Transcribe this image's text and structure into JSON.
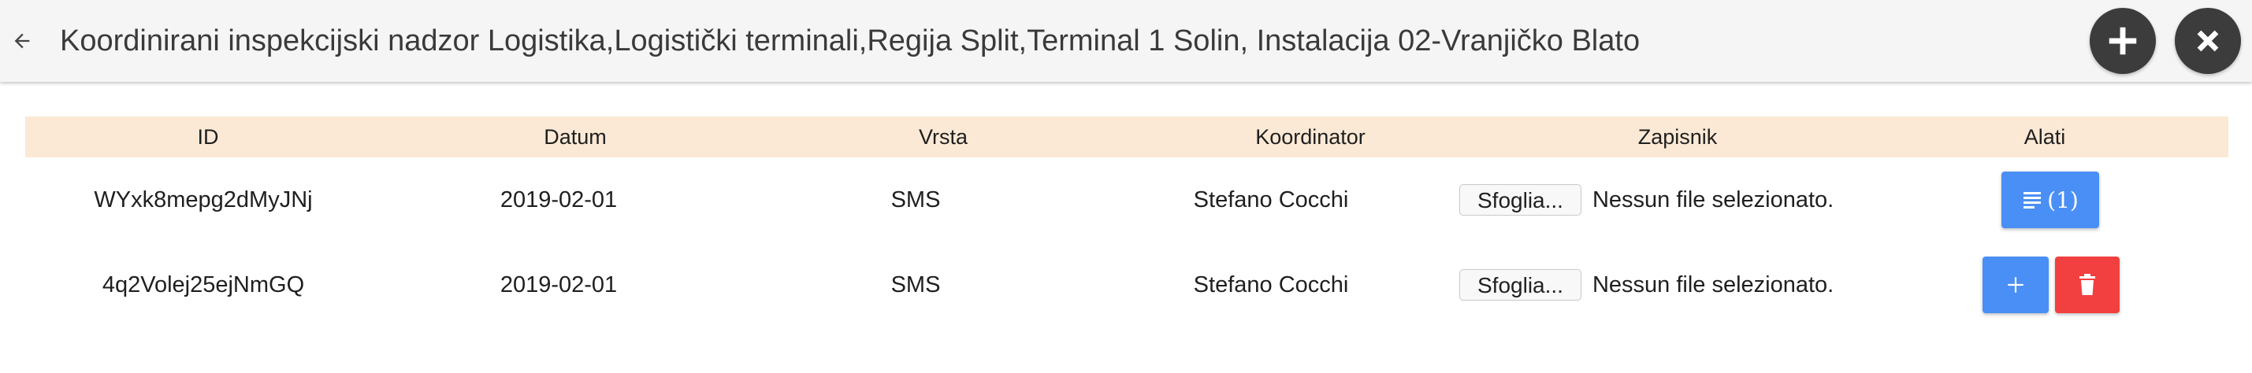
{
  "header": {
    "title": "Koordinirani inspekcijski nadzor Logistika,Logistički terminali,Regija Split,Terminal 1 Solin, Instalacija 02-Vranjičko Blato",
    "back_icon": "arrow-left-icon",
    "add_icon": "plus-circle-icon",
    "close_icon": "close-circle-icon"
  },
  "table": {
    "columns": [
      "ID",
      "Datum",
      "Vrsta",
      "Koordinator",
      "Zapisnik",
      "Alati"
    ],
    "rows": [
      {
        "id": "WYxk8mepg2dMyJNj",
        "datum": "2019-02-01",
        "vrsta": "SMS",
        "koordinator": "Stefano Cocchi",
        "file_button": "Sfoglia...",
        "file_status": "Nessun file selezionato.",
        "tools": {
          "list_count": "(1)"
        }
      },
      {
        "id": "4q2Volej25ejNmGQ",
        "datum": "2019-02-01",
        "vrsta": "SMS",
        "koordinator": "Stefano Cocchi",
        "file_button": "Sfoglia...",
        "file_status": "Nessun file selezionato."
      }
    ]
  },
  "colors": {
    "appbar_bg": "#f5f5f5",
    "header_row_bg": "#fbe9d5",
    "primary_button": "#4a8ff5",
    "danger_button": "#f24040",
    "round_button": "#3c3c3c"
  }
}
